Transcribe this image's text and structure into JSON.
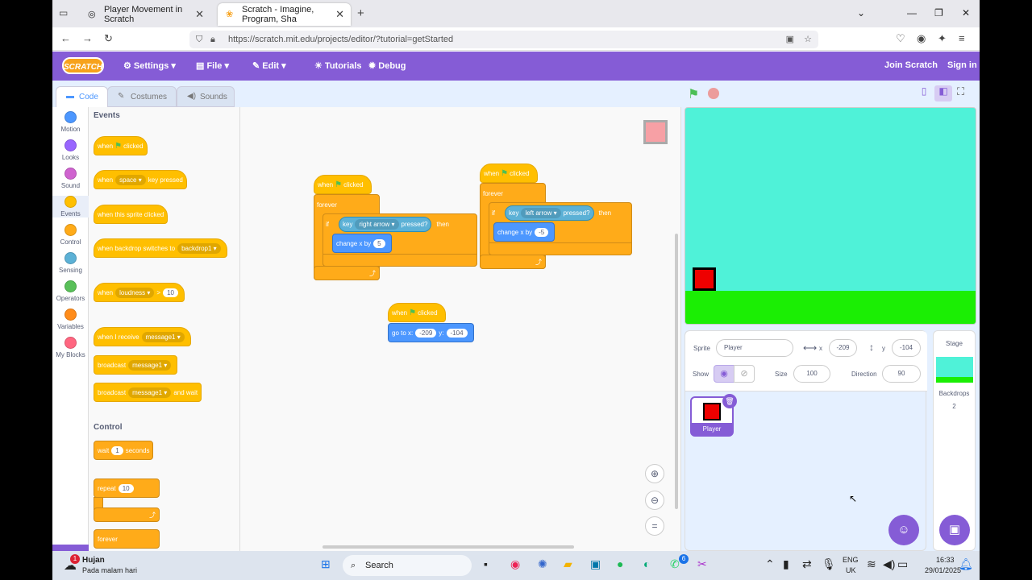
{
  "browser": {
    "tabs": [
      {
        "title": "Player Movement in Scratch"
      },
      {
        "title": "Scratch - Imagine, Program, Sha"
      }
    ],
    "url": "https://scratch.mit.edu/projects/editor/?tutorial=getStarted"
  },
  "menu": {
    "logo": "SCRATCH",
    "settings": "Settings",
    "file": "File",
    "edit": "Edit",
    "tutorials": "Tutorials",
    "debug": "Debug",
    "join": "Join Scratch",
    "signin": "Sign in"
  },
  "editor_tabs": {
    "code": "Code",
    "costumes": "Costumes",
    "sounds": "Sounds"
  },
  "categories": [
    {
      "label": "Motion",
      "color": "#4c97ff"
    },
    {
      "label": "Looks",
      "color": "#9966ff"
    },
    {
      "label": "Sound",
      "color": "#cf63cf"
    },
    {
      "label": "Events",
      "color": "#ffbf00"
    },
    {
      "label": "Control",
      "color": "#ffab19"
    },
    {
      "label": "Sensing",
      "color": "#5cb1d6"
    },
    {
      "label": "Operators",
      "color": "#59c059"
    },
    {
      "label": "Variables",
      "color": "#ff8c1a"
    },
    {
      "label": "My Blocks",
      "color": "#ff6680"
    }
  ],
  "palette": {
    "events_title": "Events",
    "control_title": "Control",
    "when": "when",
    "clicked": "clicked",
    "space": "space",
    "key_pressed": "key pressed",
    "when_sprite_clicked": "when this sprite clicked",
    "when_backdrop": "when backdrop switches to",
    "backdrop1": "backdrop1",
    "loudness": "loudness",
    "gt": ">",
    "ten": "10",
    "when_receive": "when I receive",
    "message1": "message1",
    "broadcast": "broadcast",
    "and_wait": "and wait",
    "wait": "wait",
    "one": "1",
    "seconds": "seconds",
    "repeat": "repeat",
    "forever": "forever"
  },
  "scripts": {
    "when": "when",
    "clicked": "clicked",
    "forever": "forever",
    "if": "if",
    "key": "key",
    "right_arrow": "right arrow",
    "left_arrow": "left arrow",
    "pressed": "pressed?",
    "then": "then",
    "change_x_by": "change x by",
    "right_val": "5",
    "left_val": "-5",
    "go_to_x": "go to x:",
    "y": "y:",
    "x_val": "-209",
    "y_val": "-104"
  },
  "sprite_info": {
    "sprite_label": "Sprite",
    "sprite_name": "Player",
    "x_label": "x",
    "x": "-209",
    "y_label": "y",
    "y": "-104",
    "show_label": "Show",
    "size_label": "Size",
    "size": "100",
    "direction_label": "Direction",
    "direction": "90",
    "thumb_name": "Player"
  },
  "stage_pane": {
    "title": "Stage",
    "backdrops_label": "Backdrops",
    "backdrops_count": "2"
  },
  "taskbar": {
    "weather_badge": "1",
    "weather_title": "Hujan",
    "weather_sub": "Pada malam hari",
    "search": "Search",
    "lang1": "ENG",
    "lang2": "UK",
    "time": "16:33",
    "date": "29/01/2025",
    "whatsapp_badge": "6"
  }
}
